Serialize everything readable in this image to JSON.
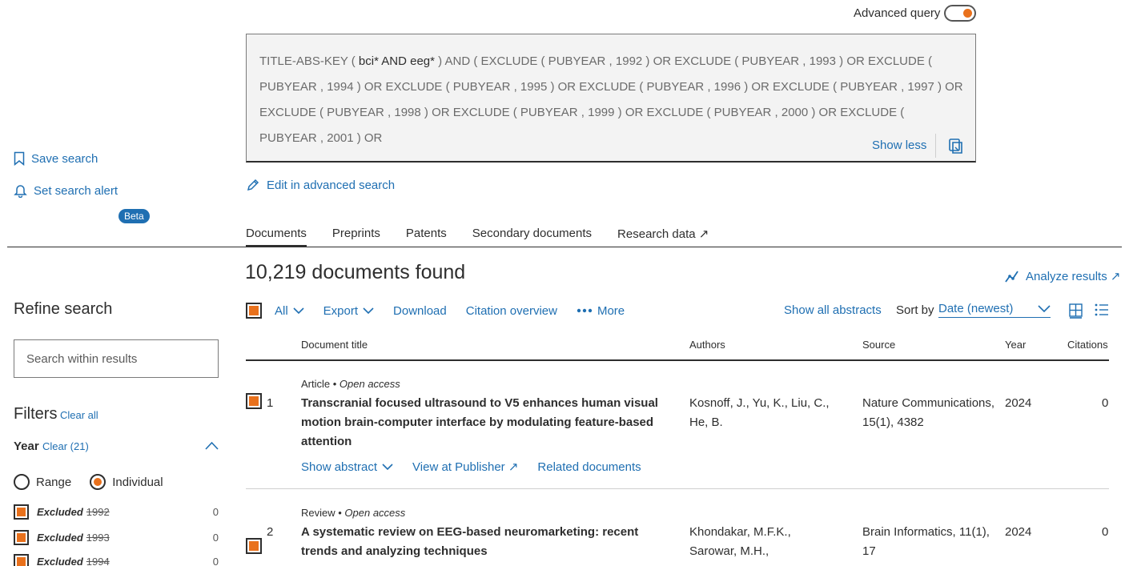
{
  "advanced": {
    "label": "Advanced query",
    "on": true
  },
  "query": {
    "prefix": "TITLE-ABS-KEY ( ",
    "term1": "bci*",
    "and": " AND ",
    "term2": "eeg*",
    "rest": " ) AND ( EXCLUDE ( PUBYEAR , 1992 ) OR EXCLUDE ( PUBYEAR , 1993 ) OR EXCLUDE ( PUBYEAR , 1994 ) OR EXCLUDE ( PUBYEAR , 1995 ) OR EXCLUDE ( PUBYEAR , 1996 ) OR EXCLUDE ( PUBYEAR , 1997 ) OR EXCLUDE ( PUBYEAR , 1998 ) OR EXCLUDE ( PUBYEAR , 1999 ) OR EXCLUDE ( PUBYEAR , 2000 ) OR EXCLUDE ( PUBYEAR , 2001 ) OR",
    "show_less": "Show less"
  },
  "edit_advanced": "Edit in advanced search",
  "sidebar_actions": {
    "save": "Save search",
    "alert": "Set search alert"
  },
  "tabs": [
    {
      "label": "Documents"
    },
    {
      "label": "Preprints",
      "badge": "Beta"
    },
    {
      "label": "Patents"
    },
    {
      "label": "Secondary documents"
    },
    {
      "label": "Research data ↗"
    }
  ],
  "results": {
    "count_text": "10,219 documents found",
    "analyze": "Analyze results ↗"
  },
  "refine": {
    "title": "Refine search",
    "search_placeholder": "Search within results",
    "filters_title": "Filters",
    "clear_all": "Clear all",
    "year_title": "Year",
    "year_clear": "Clear (21)",
    "range": "Range",
    "individual": "Individual",
    "years": [
      {
        "label": "Excluded",
        "year": "1992",
        "count": "0"
      },
      {
        "label": "Excluded",
        "year": "1993",
        "count": "0"
      },
      {
        "label": "Excluded",
        "year": "1994",
        "count": "0"
      }
    ]
  },
  "toolbar": {
    "all": "All",
    "export": "Export",
    "download": "Download",
    "citation": "Citation overview",
    "more": "More",
    "show_abstracts": "Show all abstracts",
    "sort_by": "Sort by",
    "sort_value": "Date (newest)"
  },
  "table": {
    "headers": {
      "title": "Document title",
      "authors": "Authors",
      "source": "Source",
      "year": "Year",
      "citations": "Citations"
    },
    "rows": [
      {
        "num": "1",
        "type": "Article",
        "access": "Open access",
        "title_l1": "Transcranial focused ultrasound to V5 enhances human visual",
        "title_l2": "motion brain-computer interface by modulating feature-based",
        "title_l3": "attention",
        "authors_l1": "Kosnoff, J., Yu, K., Liu, C.,",
        "authors_l2": "He, B.",
        "source_l1": "Nature Communications,",
        "source_l2": "15(1), 4382",
        "year": "2024",
        "citations": "0",
        "show_abstract": "Show abstract",
        "view_publisher": "View at Publisher ↗",
        "related": "Related documents"
      },
      {
        "num": "2",
        "type": "Review",
        "access": "Open access",
        "title_l1": "A systematic review on EEG-based neuromarketing: recent",
        "title_l2": "trends and analyzing techniques",
        "authors_l1": "Khondakar, M.F.K.,",
        "authors_l2": "Sarowar, M.H.,",
        "source_l1": "Brain Informatics, 11(1),",
        "source_l2": "17",
        "year": "2024",
        "citations": "0"
      }
    ]
  },
  "colors": {
    "accent": "#e9711c",
    "link": "#1f6fb2",
    "text": "#2e2e2e"
  }
}
